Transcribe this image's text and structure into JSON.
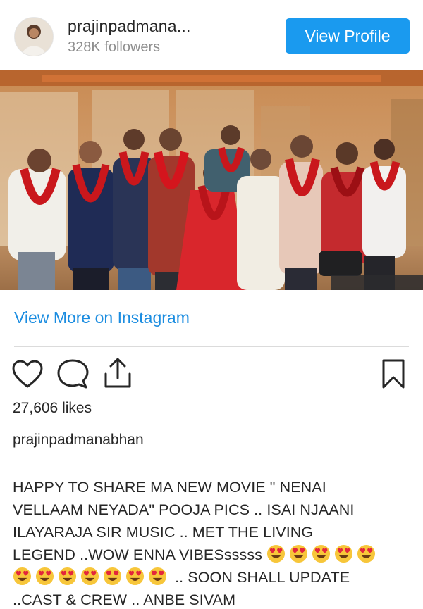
{
  "header": {
    "username": "prajinpadmana...",
    "followers": "328K followers",
    "view_profile_label": "View Profile"
  },
  "post": {
    "view_more_label": "View More on Instagram",
    "likes": "27,606 likes",
    "caption_user": "prajinpadmanabhan",
    "caption_lines": [
      "HAPPY TO SHARE MA NEW MOVIE \" NENAI",
      "VELLAAM NEYADA\" POOJA PICS .. ISAI NJAANI",
      "ILAYARAJA SIR MUSIC .. MET THE LIVING",
      "LEGEND ..WOW ENNA VIBESsssss",
      ".. SOON SHALL UPDATE",
      "..CAST & CREW .. ANBE SIVAM"
    ],
    "emoji_name": "heart-eyes-emoji"
  },
  "icons": {
    "like": "heart-outline-icon",
    "comment": "comment-bubble-icon",
    "share": "share-upload-icon",
    "save": "bookmark-icon"
  },
  "colors": {
    "accent": "#1a9aef",
    "link": "#1a8ce0",
    "muted": "#8e8e8e",
    "text": "#262626"
  }
}
